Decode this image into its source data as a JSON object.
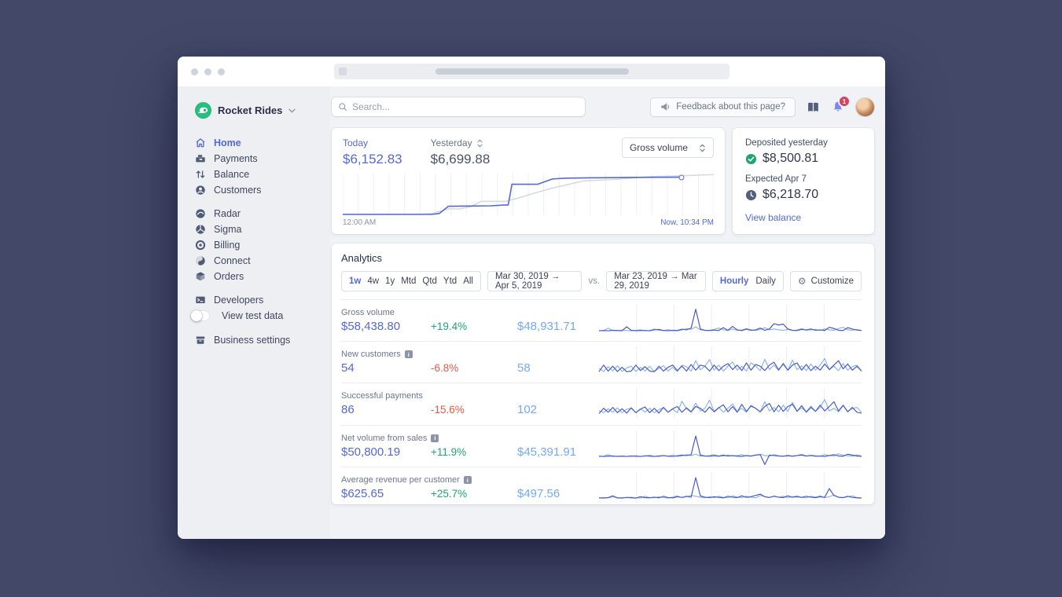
{
  "topbar": {
    "search_placeholder": "Search...",
    "feedback_label": "Feedback about this page?",
    "notification_count": "1"
  },
  "sidebar": {
    "account_name": "Rocket Rides",
    "nav_main": [
      "Home",
      "Payments",
      "Balance",
      "Customers"
    ],
    "nav_products": [
      "Radar",
      "Sigma",
      "Billing",
      "Connect",
      "Orders"
    ],
    "developers_label": "Developers",
    "toggle_label": "View test data",
    "settings_label": "Business settings"
  },
  "overview": {
    "today_label": "Today",
    "today_value": "$6,152.83",
    "yesterday_label": "Yesterday",
    "yesterday_value": "$6,699.88",
    "select_value": "Gross volume",
    "x_start": "12:00 AM",
    "x_end": "Now, 10:34 PM"
  },
  "deposits": {
    "deposited_label": "Deposited yesterday",
    "deposited_value": "$8,500.81",
    "expected_label": "Expected Apr 7",
    "expected_value": "$6,218.70",
    "link_label": "View balance"
  },
  "analytics": {
    "title": "Analytics",
    "presets": [
      "1w",
      "4w",
      "1y",
      "Mtd",
      "Qtd",
      "Ytd",
      "All"
    ],
    "active_preset": "1w",
    "range_a": "Mar 30, 2019 → Apr 5, 2019",
    "vs_label": "vs.",
    "range_b": "Mar 23, 2019 → Mar 29, 2019",
    "granularity_hourly": "Hourly",
    "granularity_daily": "Daily",
    "active_granularity": "Hourly",
    "customize_label": "Customize",
    "rows": [
      {
        "label": "Gross volume",
        "info": false,
        "current": "$58,438.80",
        "change": "+19.4%",
        "direction": "up",
        "previous": "$48,931.71"
      },
      {
        "label": "New customers",
        "info": true,
        "current": "54",
        "change": "-6.8%",
        "direction": "down",
        "previous": "58"
      },
      {
        "label": "Successful payments",
        "info": false,
        "current": "86",
        "change": "-15.6%",
        "direction": "down",
        "previous": "102"
      },
      {
        "label": "Net volume from sales",
        "info": true,
        "current": "$50,800.19",
        "change": "+11.9%",
        "direction": "up",
        "previous": "$45,391.91"
      },
      {
        "label": "Average revenue per customer",
        "info": true,
        "current": "$625.65",
        "change": "+25.7%",
        "direction": "up",
        "previous": "$497.56"
      }
    ]
  },
  "icons": {
    "info_glyph": "i",
    "gear_glyph": "⚙"
  },
  "colors": {
    "accent": "#5469d4",
    "positive": "#1ea672",
    "negative": "#e25a44",
    "previous_value": "#74a9f5",
    "spark_current": "#4a5bc8",
    "spark_previous": "#82b1ea",
    "yesterday_line": "#d4d8df",
    "brand_green": "#21b577",
    "background": "#434869"
  },
  "chart_data": {
    "overview_chart": {
      "type": "line",
      "x_start": "12:00 AM",
      "x_end": "Now, 10:34 PM",
      "series": [
        {
          "name": "Today",
          "points": [
            [
              0,
              2
            ],
            [
              24,
              2
            ],
            [
              26,
              4
            ],
            [
              28.5,
              22
            ],
            [
              34,
              22.5
            ],
            [
              40,
              23
            ],
            [
              43.5,
              25
            ],
            [
              44.6,
              25
            ],
            [
              45.6,
              76
            ],
            [
              52.5,
              76
            ],
            [
              56.5,
              89
            ],
            [
              60,
              91
            ],
            [
              68,
              92
            ],
            [
              78,
              93
            ],
            [
              91.3,
              93.5
            ]
          ]
        },
        {
          "name": "Yesterday",
          "points": [
            [
              0,
              2
            ],
            [
              21,
              2
            ],
            [
              24,
              4
            ],
            [
              28.7,
              16
            ],
            [
              31.5,
              15
            ],
            [
              34.5,
              21
            ],
            [
              37.3,
              34
            ],
            [
              44,
              34
            ],
            [
              48,
              44
            ],
            [
              52.7,
              57
            ],
            [
              56.7,
              67
            ],
            [
              64.7,
              84
            ],
            [
              73.3,
              88
            ],
            [
              83.3,
              95
            ],
            [
              91.3,
              97
            ],
            [
              100,
              100
            ]
          ]
        }
      ],
      "grid_cells": 24
    },
    "sparklines": [
      {
        "name": "Gross volume",
        "current": [
          2,
          3,
          2,
          4,
          3,
          2,
          20,
          4,
          2,
          3,
          3,
          2,
          6,
          8,
          3,
          2,
          4,
          3,
          9,
          6,
          14,
          100,
          10,
          4,
          3,
          5,
          3,
          16,
          4,
          22,
          6,
          3,
          9,
          4,
          6,
          14,
          4,
          10,
          34,
          28,
          32,
          10,
          4,
          3,
          8,
          6,
          10,
          4,
          6,
          3,
          18,
          12,
          4,
          3,
          16,
          10,
          5,
          3
        ],
        "previous": [
          3,
          2,
          14,
          3,
          2,
          5,
          3,
          2,
          4,
          6,
          2,
          3,
          10,
          4,
          3,
          7,
          3,
          2,
          5,
          12,
          8,
          20,
          6,
          3,
          4,
          8,
          14,
          6,
          3,
          10,
          4,
          5,
          12,
          6,
          3,
          8,
          16,
          6,
          10,
          6,
          4,
          8,
          3,
          5,
          12,
          4,
          6,
          8,
          3,
          10,
          6,
          4,
          12,
          18,
          6,
          4,
          8,
          3
        ]
      },
      {
        "name": "New customers",
        "current": [
          5,
          35,
          8,
          30,
          6,
          25,
          5,
          8,
          35,
          10,
          28,
          8,
          5,
          30,
          8,
          25,
          35,
          10,
          30,
          8,
          38,
          12,
          35,
          30,
          8,
          35,
          10,
          30,
          42,
          15,
          35,
          10,
          45,
          12,
          38,
          30,
          10,
          35,
          48,
          14,
          40,
          12,
          35,
          45,
          12,
          38,
          10,
          30,
          12,
          40,
          15,
          35,
          55,
          18,
          40,
          12,
          30,
          8
        ],
        "previous": [
          20,
          6,
          28,
          8,
          32,
          6,
          22,
          30,
          6,
          25,
          8,
          30,
          6,
          20,
          32,
          8,
          25,
          6,
          35,
          28,
          8,
          55,
          14,
          30,
          60,
          12,
          35,
          8,
          30,
          50,
          12,
          30,
          8,
          45,
          30,
          10,
          62,
          15,
          35,
          10,
          45,
          12,
          58,
          14,
          32,
          10,
          40,
          12,
          35,
          65,
          14,
          30,
          10,
          42,
          12,
          28,
          35,
          8
        ]
      },
      {
        "name": "Successful payments",
        "current": [
          4,
          28,
          10,
          32,
          8,
          26,
          6,
          30,
          8,
          24,
          34,
          8,
          28,
          6,
          32,
          10,
          26,
          36,
          10,
          30,
          12,
          36,
          28,
          10,
          34,
          12,
          30,
          44,
          12,
          36,
          10,
          46,
          14,
          38,
          28,
          12,
          36,
          50,
          12,
          42,
          14,
          36,
          46,
          14,
          40,
          10,
          32,
          14,
          42,
          16,
          36,
          58,
          16,
          42,
          12,
          32,
          10,
          6
        ],
        "previous": [
          18,
          8,
          26,
          10,
          30,
          8,
          24,
          28,
          8,
          26,
          10,
          28,
          8,
          22,
          30,
          10,
          24,
          8,
          60,
          26,
          10,
          52,
          16,
          28,
          65,
          14,
          32,
          10,
          28,
          48,
          14,
          28,
          10,
          42,
          28,
          12,
          58,
          16,
          32,
          12,
          42,
          14,
          55,
          16,
          30,
          12,
          38,
          14,
          32,
          68,
          16,
          28,
          12,
          40,
          14,
          26,
          32,
          10
        ]
      },
      {
        "name": "Net volume from sales",
        "current": [
          3,
          2,
          3,
          4,
          2,
          3,
          2,
          4,
          3,
          2,
          5,
          3,
          2,
          4,
          6,
          3,
          2,
          5,
          8,
          6,
          10,
          95,
          8,
          4,
          3,
          5,
          3,
          8,
          4,
          6,
          3,
          2,
          6,
          4,
          8,
          10,
          -35,
          8,
          6,
          4,
          3,
          5,
          3,
          6,
          8,
          4,
          6,
          3,
          4,
          2,
          6,
          10,
          4,
          3,
          12,
          8,
          4,
          2
        ],
        "previous": [
          2,
          3,
          10,
          2,
          3,
          4,
          2,
          3,
          5,
          2,
          3,
          8,
          3,
          2,
          6,
          3,
          8,
          2,
          4,
          10,
          6,
          12,
          4,
          3,
          6,
          10,
          4,
          3,
          8,
          4,
          6,
          10,
          4,
          3,
          8,
          12,
          6,
          4,
          10,
          5,
          3,
          8,
          4,
          6,
          12,
          4,
          8,
          5,
          3,
          10,
          6,
          4,
          14,
          8,
          5,
          3,
          9,
          4
        ]
      },
      {
        "name": "Average revenue per customer",
        "current": [
          3,
          2,
          4,
          12,
          3,
          2,
          5,
          3,
          2,
          8,
          4,
          3,
          6,
          3,
          10,
          4,
          3,
          8,
          5,
          10,
          6,
          95,
          12,
          6,
          4,
          8,
          5,
          3,
          10,
          6,
          4,
          12,
          5,
          8,
          14,
          20,
          8,
          5,
          10,
          6,
          4,
          12,
          6,
          8,
          5,
          10,
          6,
          4,
          8,
          5,
          45,
          14,
          6,
          4,
          10,
          5,
          3,
          2
        ],
        "previous": [
          2,
          4,
          3,
          8,
          2,
          4,
          3,
          6,
          3,
          2,
          10,
          4,
          3,
          8,
          4,
          2,
          6,
          12,
          4,
          8,
          14,
          10,
          6,
          3,
          8,
          4,
          10,
          5,
          3,
          12,
          6,
          4,
          10,
          6,
          3,
          14,
          8,
          4,
          12,
          6,
          10,
          4,
          8,
          12,
          5,
          3,
          10,
          6,
          12,
          4,
          8,
          16,
          5,
          3,
          8,
          12,
          4,
          3
        ]
      }
    ],
    "grid_cells_per_sparkline": 7
  }
}
